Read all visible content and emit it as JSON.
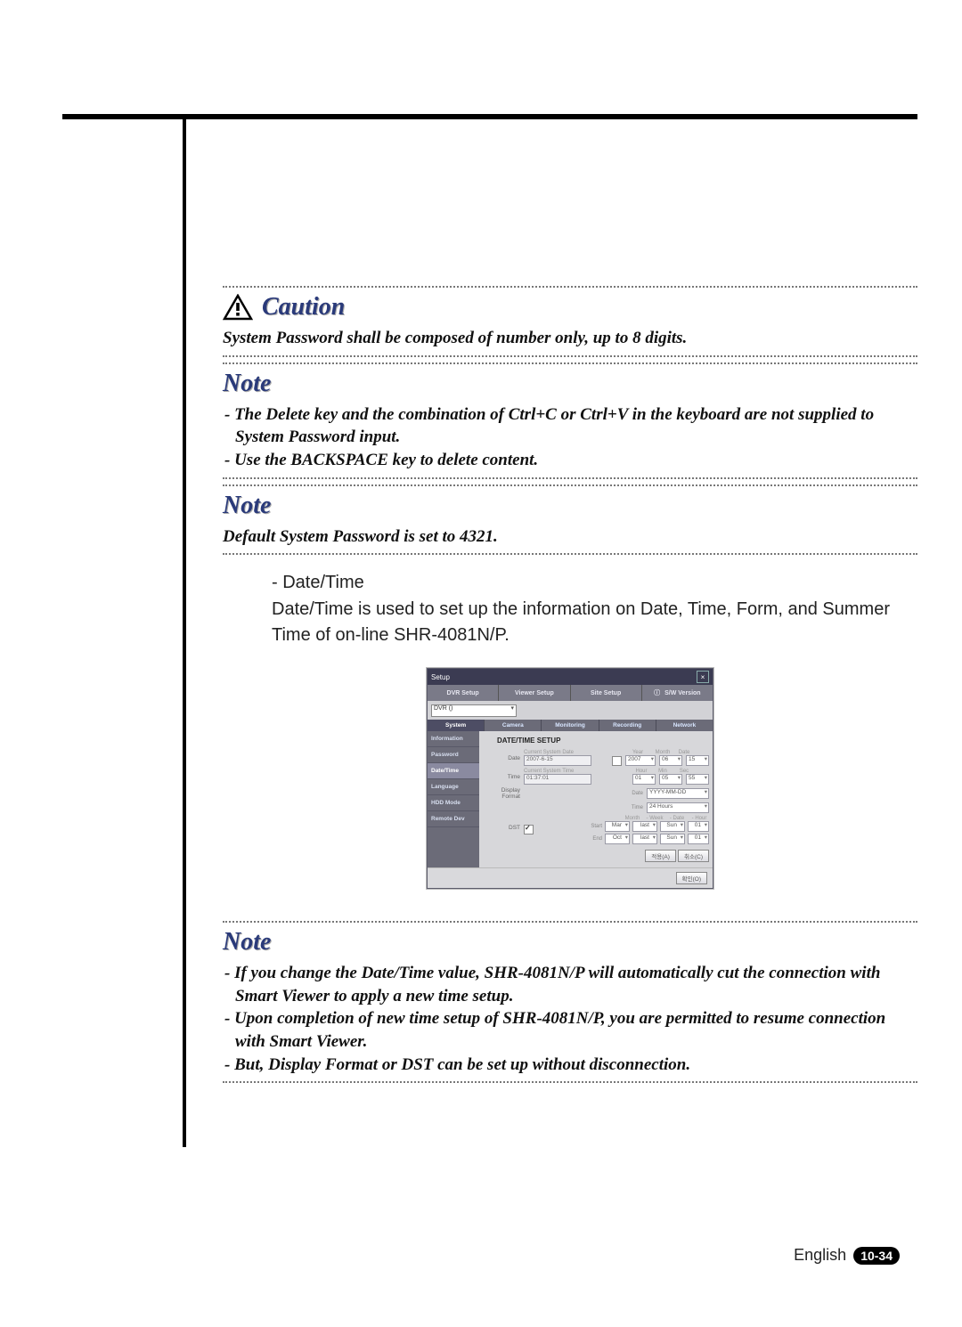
{
  "caution": {
    "label": "Caution",
    "text": "System Password shall be composed of number only, up to 8 digits."
  },
  "note1": {
    "label": "Note",
    "items": [
      "- The Delete key and the combination of Ctrl+C or Ctrl+V in the keyboard are not supplied to System Password input.",
      "- Use the BACKSPACE key to delete content."
    ]
  },
  "note2": {
    "label": "Note",
    "text": "Default System Password is set to 4321."
  },
  "section": {
    "bullet": "- Date/Time",
    "text": "Date/Time is used to set up the information on Date, Time, Form, and Summer Time of on-line SHR-4081N/P."
  },
  "note3": {
    "label": "Note",
    "items": [
      "- If you change the Date/Time value, SHR-4081N/P will automatically cut the connection with Smart Viewer to apply a new time setup.",
      "- Upon completion of new time setup of SHR-4081N/P, you are permitted to resume connection with Smart Viewer.",
      "- But, Display Format or DST can be set up without disconnection."
    ]
  },
  "footer": {
    "lang": "English",
    "page": "10-34"
  },
  "setup": {
    "title": "Setup",
    "tabs": [
      "DVR Setup",
      "Viewer Setup",
      "Site Setup",
      "S/W Version"
    ],
    "dvr_selector": "DVR ()",
    "subtabs": [
      "System",
      "Camera",
      "Monitoring",
      "Recording",
      "Network"
    ],
    "sidemenu": [
      "Information",
      "Password",
      "Date/Time",
      "Language",
      "HDD Mode",
      "Remote Dev"
    ],
    "sidemenu_active": "Date/Time",
    "panel_title": "DATE/TIME SETUP",
    "date": {
      "label": "Date",
      "cur_lbl": "Current System Date",
      "cur_val": "2007-6-15",
      "hdr": [
        "Year",
        "Month",
        "Date"
      ],
      "vals": [
        "2007",
        "06",
        "15"
      ]
    },
    "time": {
      "label": "Time",
      "cur_lbl": "Current System Time",
      "cur_val": "01:37:01",
      "hdr": [
        "Hour",
        "Min",
        "Sec"
      ],
      "vals": [
        "01",
        "05",
        "55"
      ]
    },
    "fmt": {
      "label": "Display Format",
      "date_lbl": "Date",
      "date_val": "YYYY-MM-DD",
      "time_lbl": "Time",
      "time_val": "24 Hours"
    },
    "dst": {
      "label": "DST",
      "cols": [
        "Month",
        "Week",
        "Date",
        "Hour"
      ],
      "start_lbl": "Start",
      "start": [
        "Mar",
        "last",
        "Sun",
        "01"
      ],
      "end_lbl": "End",
      "end": [
        "Oct",
        "last",
        "Sun",
        "01"
      ]
    },
    "buttons": {
      "apply": "적용(A)",
      "cancel": "취소(C)",
      "ok": "확인(O)"
    }
  }
}
